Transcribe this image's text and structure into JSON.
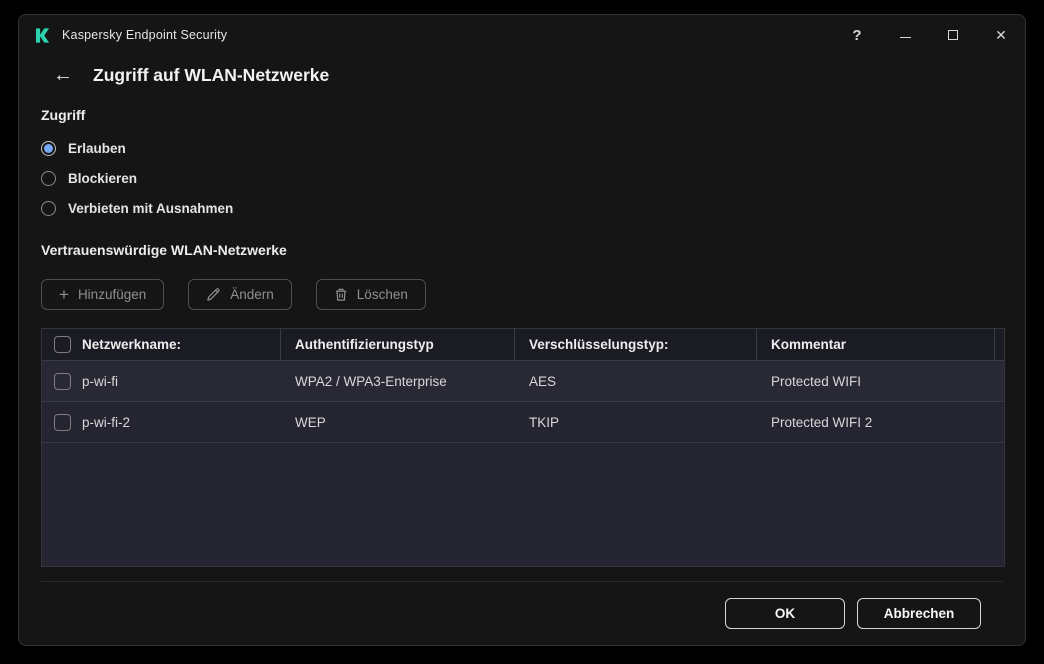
{
  "window": {
    "title": "Kaspersky Endpoint Security",
    "controls": {
      "help": "?",
      "close": "✕"
    }
  },
  "page": {
    "back_icon": "←",
    "title": "Zugriff auf WLAN-Netzwerke"
  },
  "access": {
    "label": "Zugriff",
    "options": [
      {
        "label": "Erlauben",
        "selected": true
      },
      {
        "label": "Blockieren",
        "selected": false
      },
      {
        "label": "Verbieten mit Ausnahmen",
        "selected": false
      }
    ]
  },
  "trusted": {
    "label": "Vertrauenswürdige WLAN-Netzwerke",
    "toolbar": {
      "add": "Hinzufügen",
      "edit": "Ändern",
      "delete": "Löschen"
    },
    "table": {
      "headers": [
        "Netzwerkname:",
        "Authentifizierungstyp",
        "Verschlüsselungstyp:",
        "Kommentar"
      ],
      "rows": [
        {
          "name": "p-wi-fi",
          "auth": "WPA2 / WPA3-Enterprise",
          "encryption": "AES",
          "comment": "Protected WIFI",
          "checked": false
        },
        {
          "name": "p-wi-fi-2",
          "auth": "WEP",
          "encryption": "TKIP",
          "comment": "Protected WIFI 2",
          "checked": false
        }
      ]
    }
  },
  "footer": {
    "ok": "OK",
    "cancel": "Abbrechen"
  },
  "colors": {
    "accent_blue": "#76a8f5",
    "kaspersky_teal": "#2bd4ae"
  }
}
